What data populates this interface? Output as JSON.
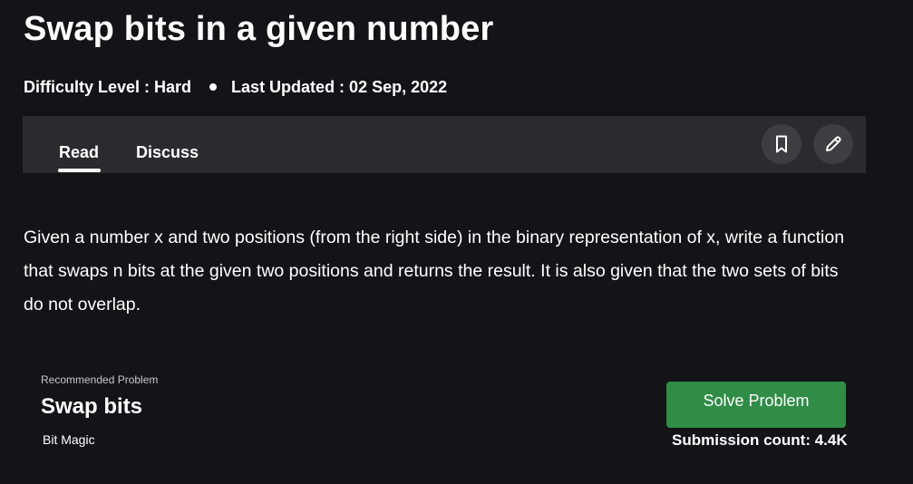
{
  "article": {
    "title": "Swap bits in a given number",
    "difficulty": "Difficulty Level : Hard",
    "last_updated": "Last Updated : 02 Sep, 2022",
    "description": "Given a number x and two positions (from the right side) in the binary representation of x, write a function that swaps n bits at the given two positions and returns the result. It is also given that the two sets of bits do not overlap."
  },
  "tabs": {
    "read": "Read",
    "discuss": "Discuss",
    "active": "Read"
  },
  "toolbar": {
    "bookmark_icon": "bookmark-icon",
    "edit_icon": "pencil-icon"
  },
  "recommended": {
    "label": "Recommended Problem",
    "title": "Swap bits",
    "tag": "Bit Magic",
    "solve_label": "Solve Problem",
    "submission_count": "Submission count: 4.4K"
  },
  "colors": {
    "background": "#131417",
    "tabbar": "#2a2b2e",
    "icon_button": "#3d3e42",
    "solve_button": "#2f8d46"
  }
}
